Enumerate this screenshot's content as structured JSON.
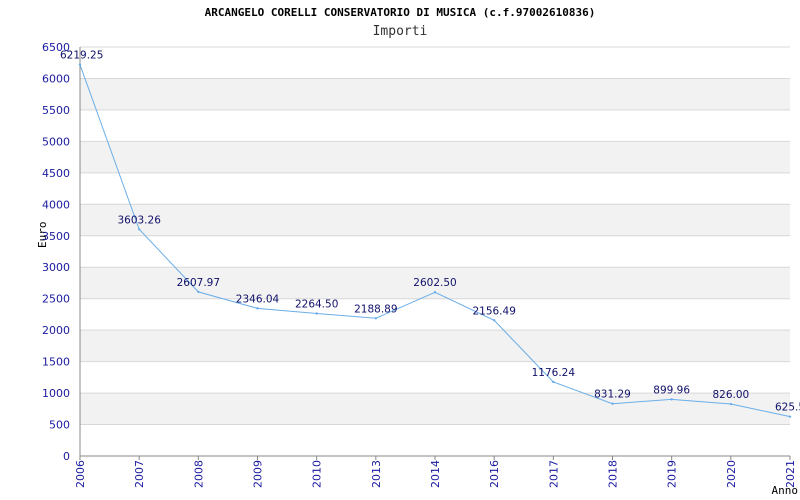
{
  "title": "ARCANGELO CORELLI CONSERVATORIO DI MUSICA (c.f.97002610836)",
  "subtitle": "Importi",
  "chart_data": {
    "type": "line",
    "title": "ARCANGELO CORELLI CONSERVATORIO DI MUSICA (c.f.97002610836)",
    "subtitle": "Importi",
    "xlabel": "Anno",
    "ylabel": "Euro",
    "categories": [
      "2006",
      "2007",
      "2008",
      "2009",
      "2010",
      "2013",
      "2014",
      "2016",
      "2017",
      "2018",
      "2019",
      "2020",
      "2021"
    ],
    "series": [
      {
        "values": [
          6219.25,
          3603.26,
          2607.97,
          2346.04,
          2264.5,
          2188.89,
          2602.5,
          2156.49,
          1176.24,
          831.29,
          899.96,
          826.0,
          625.5
        ],
        "labels": [
          "6219.25",
          "3603.26",
          "2607.97",
          "2346.04",
          "2264.50",
          "2188.89",
          "2602.50",
          "2156.49",
          "1176.24",
          "831.29",
          "899.96",
          "826.00",
          "625.5"
        ]
      }
    ],
    "ylim": [
      0,
      6500
    ],
    "yticks": [
      0,
      500,
      1000,
      1500,
      2000,
      2500,
      3000,
      3500,
      4000,
      4500,
      5000,
      5500,
      6000,
      6500
    ],
    "grid": "horizontal alternating bands",
    "colors": {
      "line": "#6aaee8",
      "band": "#f2f2f2",
      "grid": "#d8d8d8",
      "tick": "#1a1aa0",
      "label": "#10106a"
    }
  }
}
